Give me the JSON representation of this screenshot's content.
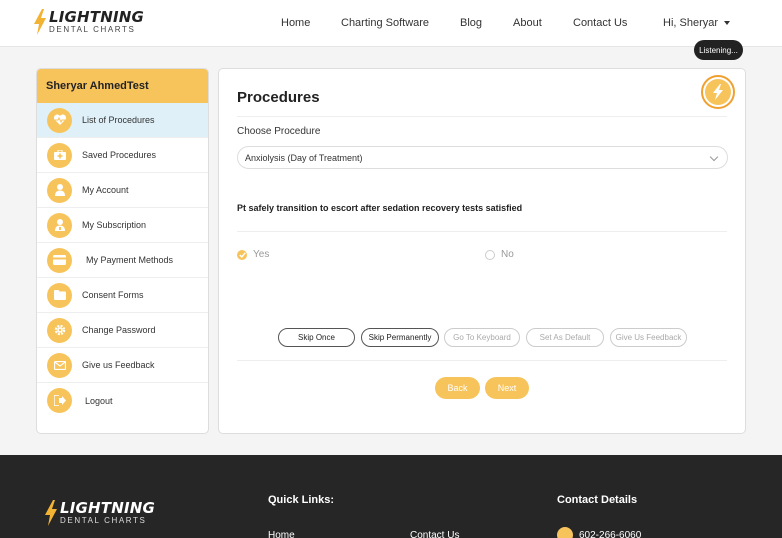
{
  "brand": {
    "name": "LIGHTNING",
    "tagline": "DENTAL CHARTS",
    "accent": "#f7c45c"
  },
  "nav": {
    "items": [
      "Home",
      "Charting Software",
      "Blog",
      "About",
      "Contact Us"
    ],
    "user_menu": "Hi, Sheryar"
  },
  "voice": {
    "status": "Listening..."
  },
  "sidebar": {
    "user_name": "Sheryar AhmedTest",
    "items": [
      {
        "label": "List of Procedures",
        "icon": "heart-pulse-icon",
        "active": true
      },
      {
        "label": "Saved Procedures",
        "icon": "medical-kit-icon"
      },
      {
        "label": "My Account",
        "icon": "user-icon"
      },
      {
        "label": "My Subscription",
        "icon": "user-badge-icon"
      },
      {
        "label": "My Payment Methods",
        "icon": "credit-card-icon"
      },
      {
        "label": "Consent Forms",
        "icon": "folder-icon"
      },
      {
        "label": "Change Password",
        "icon": "gear-icon"
      },
      {
        "label": "Give us Feedback",
        "icon": "envelope-icon"
      },
      {
        "label": "Logout",
        "icon": "logout-icon"
      }
    ]
  },
  "main": {
    "title": "Procedures",
    "choose_label": "Choose Procedure",
    "selected_procedure": "Anxiolysis (Day of Treatment)",
    "question": "Pt safely transition to escort after sedation recovery tests satisfied",
    "options": {
      "yes": "Yes",
      "no": "No",
      "selected": "yes"
    },
    "actions": [
      "Skip Once",
      "Skip Permanently",
      "Go To Keyboard",
      "Set As Default",
      "Give Us Feedback"
    ],
    "back_label": "Back",
    "next_label": "Next"
  },
  "footer": {
    "quick_links_heading": "Quick Links:",
    "contact_heading": "Contact Details",
    "links": [
      "Home",
      "Contact Us"
    ],
    "phone": "602-266-6060"
  }
}
